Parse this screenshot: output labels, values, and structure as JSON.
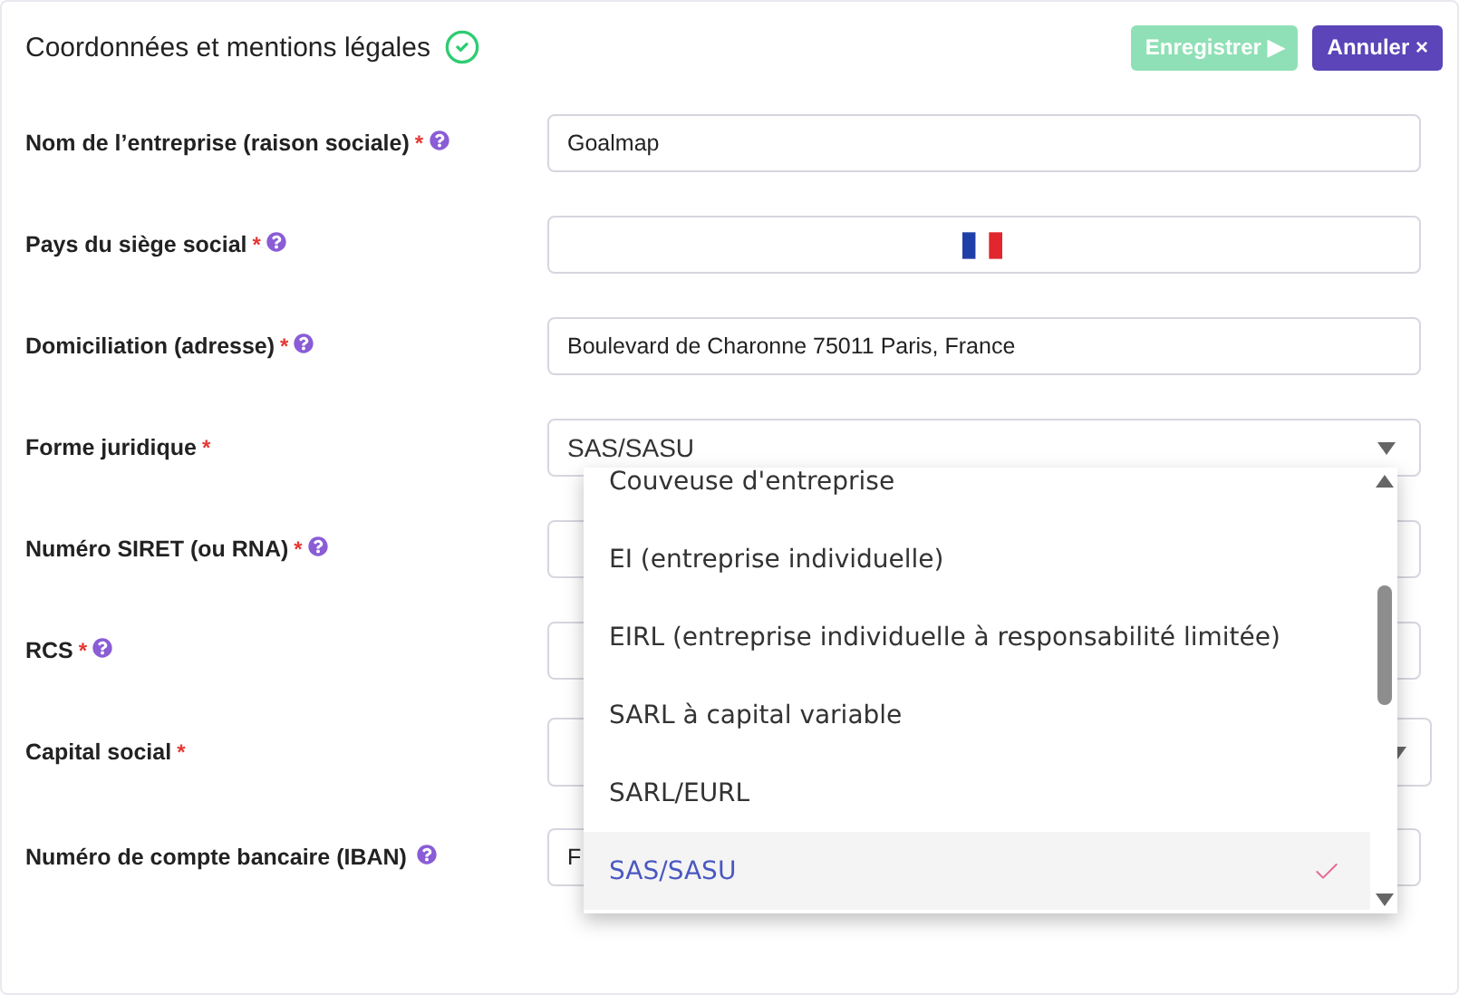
{
  "header": {
    "title": "Coordonnées et mentions légales",
    "complete": true
  },
  "buttons": [
    {
      "label": "Enregistrer",
      "glyph": "▶",
      "kind": "save",
      "disabled": true
    },
    {
      "label": "Annuler",
      "glyph": "×",
      "kind": "cancel",
      "disabled": false
    }
  ],
  "fields": [
    {
      "label": "Nom de l’entreprise (raison sociale)",
      "mark": "*",
      "help": true,
      "kind": "text",
      "value": "Goalmap"
    },
    {
      "label": "Pays du siège social",
      "mark": "*",
      "help": true,
      "kind": "country"
    },
    {
      "label": "Domiciliation (adresse)",
      "mark": "*",
      "help": true,
      "kind": "text",
      "value": "Boulevard de Charonne 75011 Paris, France"
    },
    {
      "label": "Forme juridique",
      "mark": "*",
      "help": false,
      "kind": "select",
      "value": "SAS/SASU"
    },
    {
      "label": "Numéro SIRET (ou RNA)",
      "mark": "*",
      "help": true,
      "kind": "text"
    },
    {
      "label": "RCS",
      "mark": "*",
      "help": true,
      "kind": "text"
    },
    {
      "label": "Capital social",
      "mark": "*",
      "help": false,
      "kind": "select"
    },
    {
      "label": "Numéro de compte bancaire (IBAN)",
      "help": true,
      "kind": "text",
      "value": "F"
    }
  ],
  "dropdown": {
    "options": [
      {
        "label": "Couveuse d'entreprise",
        "selected": false
      },
      {
        "label": "EI (entreprise individuelle)",
        "selected": false
      },
      {
        "label": "EIRL (entreprise individuelle à responsabilité limitée)",
        "selected": false
      },
      {
        "label": "SARL à capital variable",
        "selected": false
      },
      {
        "label": "SARL/EURL",
        "selected": false
      },
      {
        "label": "SAS/SASU",
        "selected": true
      }
    ]
  }
}
